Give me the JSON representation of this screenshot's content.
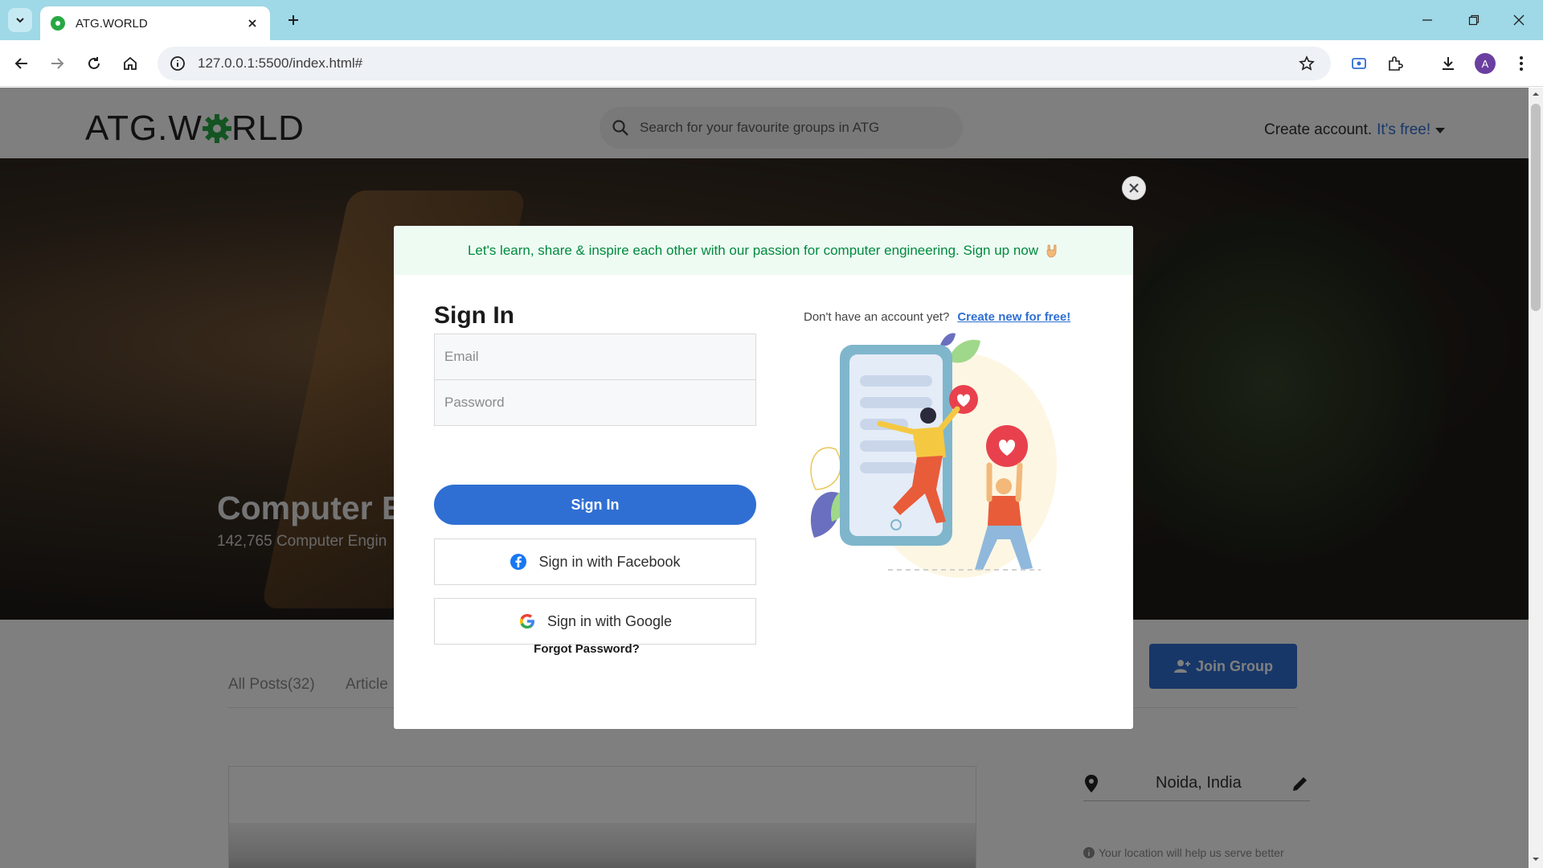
{
  "browser": {
    "tab_title": "ATG.WORLD",
    "url": "127.0.0.1:5500/index.html#",
    "profile_initial": "A"
  },
  "site": {
    "logo": {
      "part1": "ATG.W",
      "part2": "RLD"
    },
    "search_placeholder": "Search for your favourite groups in ATG",
    "create_account": "Create account.",
    "create_account_free": "It's free!"
  },
  "hero": {
    "title": "Computer E",
    "subtitle": "142,765 Computer Engin"
  },
  "post_tabs": [
    "All Posts(32)",
    "Article"
  ],
  "join_group_label": "Join Group",
  "location": {
    "value": "Noida, India",
    "hint": "Your location will help us serve better"
  },
  "modal": {
    "banner": "Let's learn, share & inspire each other with our passion for computer engineering. Sign up now",
    "title": "Sign In",
    "email_placeholder": "Email",
    "password_placeholder": "Password",
    "signin_button": "Sign In",
    "facebook_button": "Sign in with Facebook",
    "google_button": "Sign in with Google",
    "forgot_password": "Forgot Password?",
    "no_account_prompt": "Don't have an account yet?",
    "create_link": "Create new for free!"
  },
  "colors": {
    "brand_green": "#27a844",
    "primary_blue": "#2f6fd3",
    "banner_bg": "#eefbf3",
    "banner_text": "#008a3e"
  }
}
